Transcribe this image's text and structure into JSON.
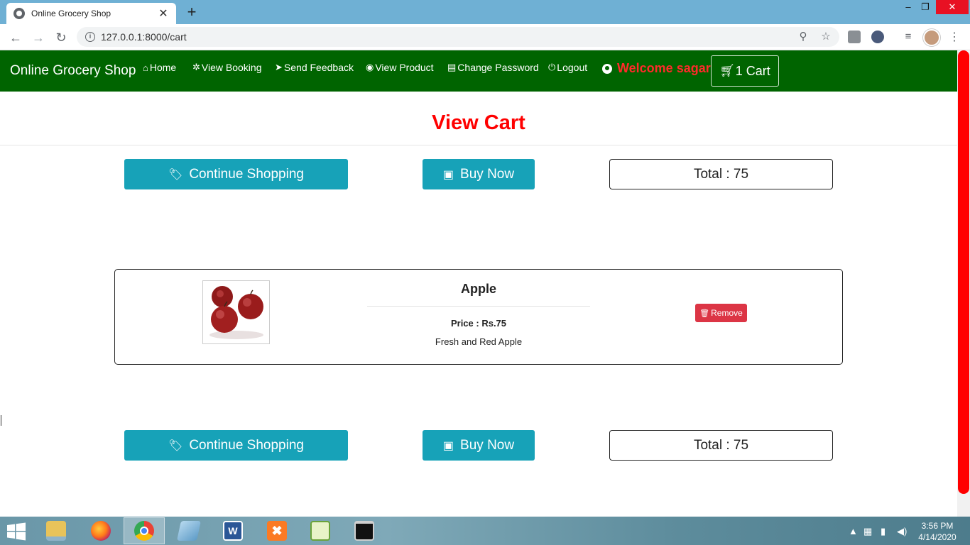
{
  "browser": {
    "tab_title": "Online Grocery Shop",
    "tab_close": "✕",
    "new_tab": "+",
    "url": "127.0.0.1:8000/cart",
    "window_controls": {
      "minimize": "–",
      "maximize": "❐",
      "close": "✕"
    }
  },
  "navbar": {
    "brand": "Online Grocery Shop",
    "links": [
      {
        "label": "Home",
        "icon": "home-icon"
      },
      {
        "label": "View Booking",
        "icon": "gear-icon"
      },
      {
        "label": "Send Feedback",
        "icon": "send-icon"
      },
      {
        "label": "View Product",
        "icon": "eye-icon"
      },
      {
        "label": "Change Password",
        "icon": "file-icon"
      },
      {
        "label": "Logout",
        "icon": "power-icon"
      }
    ],
    "welcome": "Welcome sagar",
    "cart_label": "1 Cart"
  },
  "page": {
    "title": "View Cart",
    "continue_label": "Continue Shopping",
    "buy_label": "Buy Now",
    "total_label": "Total : 75"
  },
  "cart_items": [
    {
      "name": "Apple",
      "price": "Price : Rs.75",
      "description": "Fresh and Red Apple",
      "remove_label": "Remove"
    }
  ],
  "taskbar": {
    "time": "3:56 PM",
    "date": "4/14/2020",
    "apps": [
      "file-explorer",
      "firefox",
      "chrome",
      "notepad",
      "word",
      "xampp",
      "notepad-plus-plus",
      "command-prompt"
    ]
  },
  "colors": {
    "navbar_bg": "#006400",
    "accent_red": "#ff0000",
    "button_info": "#17a2b8",
    "button_danger": "#dc3545"
  }
}
